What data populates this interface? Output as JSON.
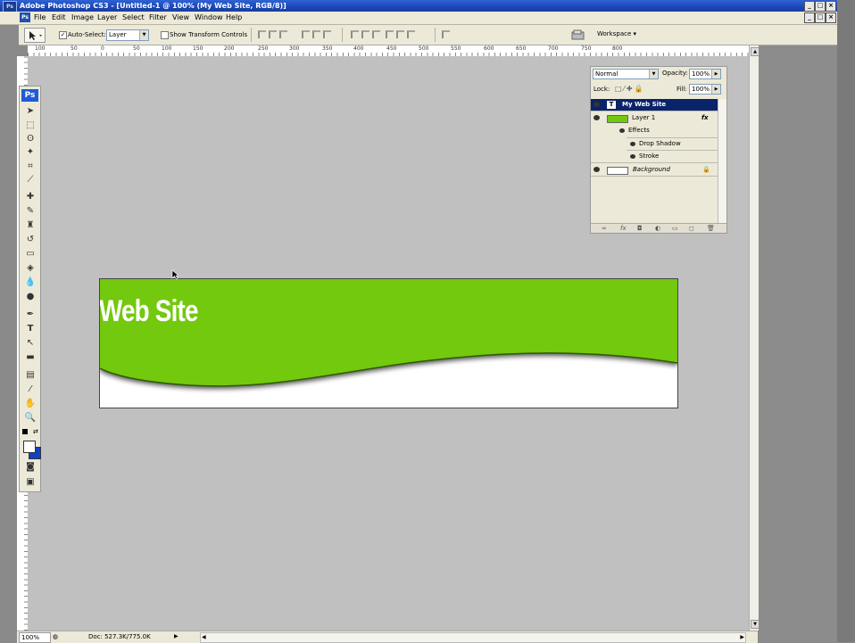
{
  "window": {
    "title": "Adobe Photoshop CS3 - [Untitled-1 @ 100% (My Web Site, RGB/8)]",
    "app_icon": "Ps"
  },
  "menu": [
    "File",
    "Edit",
    "Image",
    "Layer",
    "Select",
    "Filter",
    "View",
    "Window",
    "Help"
  ],
  "options_bar": {
    "auto_select_label": "Auto-Select:",
    "auto_select_checked": true,
    "auto_select_value": "Layer",
    "show_transform_label": "Show Transform Controls",
    "show_transform_checked": false,
    "workspace_label": "Workspace ▾"
  },
  "toolbox": {
    "badge": "Ps"
  },
  "ruler": {
    "labels": [
      "100",
      "50",
      "0",
      "50",
      "100",
      "150",
      "200",
      "250",
      "300",
      "350",
      "400",
      "450",
      "500",
      "550",
      "600",
      "650",
      "700",
      "750",
      "800"
    ]
  },
  "document": {
    "heading": "Web Site",
    "band_color": "#72c90b",
    "background_color": "#ffffff"
  },
  "layers_panel": {
    "blend_mode": "Normal",
    "opacity_label": "Opacity:",
    "opacity": "100%",
    "lock_label": "Lock:",
    "fill_label": "Fill:",
    "fill": "100%",
    "layers": [
      {
        "name": "My Web Site",
        "type": "text",
        "selected": true
      },
      {
        "name": "Layer 1",
        "type": "pixel",
        "fx": "fx"
      },
      {
        "name": "Effects",
        "type": "effects"
      },
      {
        "name": "Drop Shadow",
        "type": "effect"
      },
      {
        "name": "Stroke",
        "type": "effect"
      },
      {
        "name": "Background",
        "type": "background"
      }
    ]
  },
  "status_bar": {
    "zoom": "100%",
    "doc_info": "Doc: 527.3K/775.0K"
  }
}
